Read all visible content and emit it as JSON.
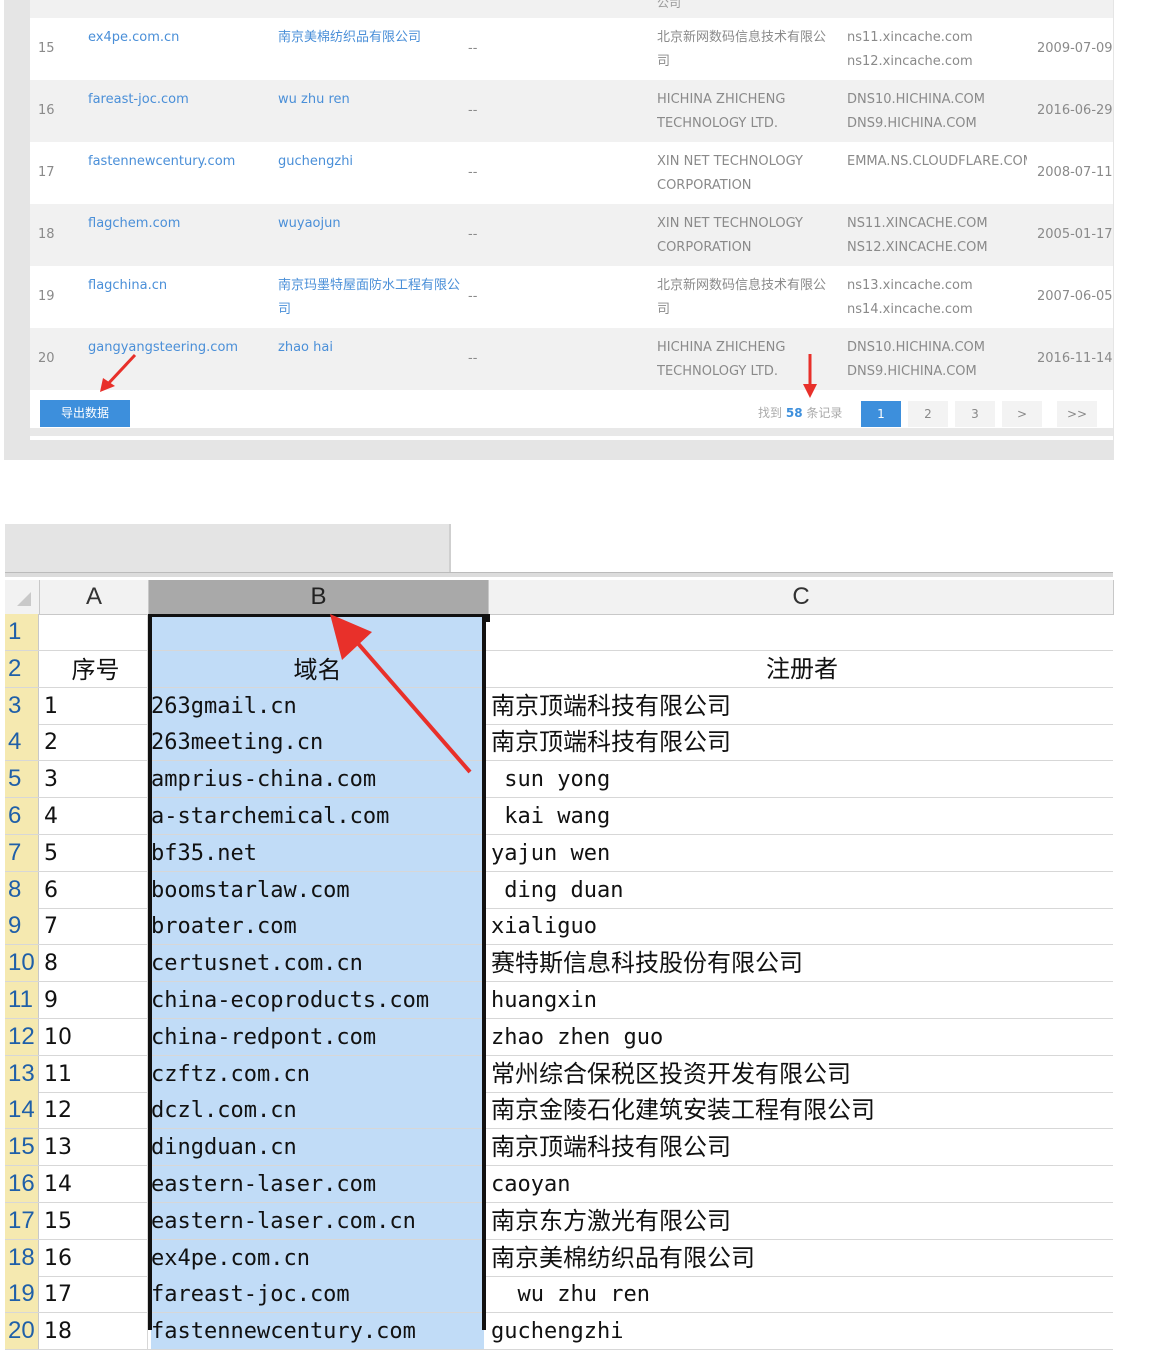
{
  "web_table": {
    "partial_top_text": "公司",
    "rows": [
      {
        "num": "15",
        "domain": "ex4pe.com.cn",
        "registrant": "南京美棉纺织品有限公司",
        "dash": "--",
        "registrar": "北京新网数码信息技术有限公司",
        "ns": "ns11.xincache.com ns12.xincache.com",
        "date": "2009-07-09"
      },
      {
        "num": "16",
        "domain": "fareast-joc.com",
        "registrant": "wu zhu ren",
        "dash": "--",
        "registrar": "HICHINA ZHICHENG TECHNOLOGY LTD.",
        "ns": "DNS10.HICHINA.COM DNS9.HICHINA.COM",
        "date": "2016-06-29"
      },
      {
        "num": "17",
        "domain": "fastennewcentury.com",
        "registrant": "guchengzhi",
        "dash": "--",
        "registrar": "XIN NET TECHNOLOGY CORPORATION",
        "ns": "EMMA.NS.CLOUDFLARE.COM",
        "date": "2008-07-11"
      },
      {
        "num": "18",
        "domain": "flagchem.com",
        "registrant": "wuyaojun",
        "dash": "--",
        "registrar": "XIN NET TECHNOLOGY CORPORATION",
        "ns": "NS11.XINCACHE.COM NS12.XINCACHE.COM",
        "date": "2005-01-17"
      },
      {
        "num": "19",
        "domain": "flagchina.cn",
        "registrant": "南京玛墨特屋面防水工程有限公司",
        "dash": "--",
        "registrar": "北京新网数码信息技术有限公司",
        "ns": "ns13.xincache.com ns14.xincache.com",
        "date": "2007-06-05"
      },
      {
        "num": "20",
        "domain": "gangyangsteering.com",
        "registrant": "zhao hai",
        "dash": "--",
        "registrar": "HICHINA ZHICHENG TECHNOLOGY LTD.",
        "ns": "DNS10.HICHINA.COM DNS9.HICHINA.COM",
        "date": "2016-11-14"
      }
    ],
    "export_label": "导出数据",
    "pager": {
      "prefix": "找到",
      "count": "58",
      "suffix": "条记录",
      "pages": [
        "1",
        "2",
        "3",
        ">",
        ">>"
      ]
    }
  },
  "excel": {
    "columns": [
      "A",
      "B",
      "C"
    ],
    "rows": [
      {
        "r": "1",
        "a": "",
        "b": "",
        "c": ""
      },
      {
        "r": "2",
        "a": "序号",
        "b": "域名",
        "c": "注册者"
      },
      {
        "r": "3",
        "a": "1",
        "b": "263gmail.cn",
        "c": "南京顶端科技有限公司"
      },
      {
        "r": "4",
        "a": "2",
        "b": "263meeting.cn",
        "c": "南京顶端科技有限公司"
      },
      {
        "r": "5",
        "a": "3",
        "b": "amprius-china.com",
        "c": " sun yong"
      },
      {
        "r": "6",
        "a": "4",
        "b": "a-starchemical.com",
        "c": " kai wang"
      },
      {
        "r": "7",
        "a": "5",
        "b": "bf35.net",
        "c": "yajun wen"
      },
      {
        "r": "8",
        "a": "6",
        "b": "boomstarlaw.com",
        "c": " ding duan"
      },
      {
        "r": "9",
        "a": "7",
        "b": "broater.com",
        "c": "xialiguo"
      },
      {
        "r": "10",
        "a": "8",
        "b": "certusnet.com.cn",
        "c": "赛特斯信息科技股份有限公司"
      },
      {
        "r": "11",
        "a": "9",
        "b": "china-ecoproducts.com",
        "c": "huangxin"
      },
      {
        "r": "12",
        "a": "10",
        "b": "china-redpont.com",
        "c": "zhao zhen guo"
      },
      {
        "r": "13",
        "a": "11",
        "b": "czftz.com.cn",
        "c": "常州综合保税区投资开发有限公司"
      },
      {
        "r": "14",
        "a": "12",
        "b": "dczl.com.cn",
        "c": "南京金陵石化建筑安装工程有限公司"
      },
      {
        "r": "15",
        "a": "13",
        "b": "dingduan.cn",
        "c": "南京顶端科技有限公司"
      },
      {
        "r": "16",
        "a": "14",
        "b": "eastern-laser.com",
        "c": "caoyan"
      },
      {
        "r": "17",
        "a": "15",
        "b": "eastern-laser.com.cn",
        "c": "南京东方激光有限公司"
      },
      {
        "r": "18",
        "a": "16",
        "b": "ex4pe.com.cn",
        "c": "南京美棉纺织品有限公司"
      },
      {
        "r": "19",
        "a": "17",
        "b": "fareast-joc.com",
        "c": "  wu zhu ren"
      },
      {
        "r": "20",
        "a": "18",
        "b": "fastennewcentury.com",
        "c": "guchengzhi"
      }
    ]
  },
  "colors": {
    "link": "#4a8fd8",
    "accent": "#3d8fdc",
    "selection": "#c1dcf7",
    "arrow": "#e8302a",
    "rowheader": "#f5e9b0"
  }
}
